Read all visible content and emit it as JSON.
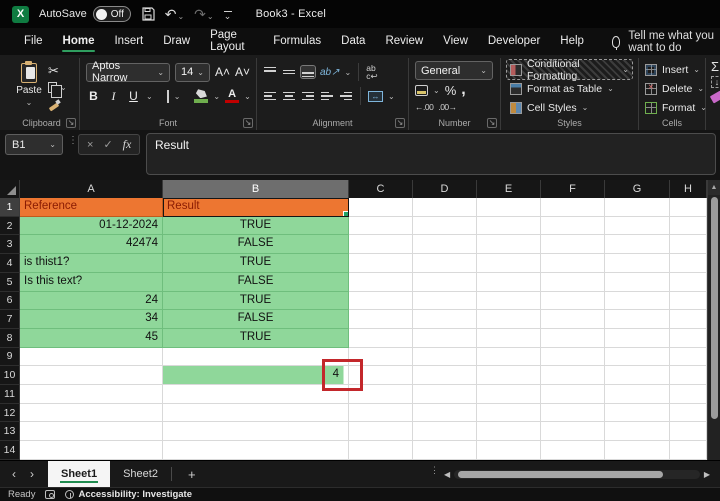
{
  "titlebar": {
    "app_initial": "X",
    "autosave_label": "AutoSave",
    "autosave_state": "Off",
    "doc_title": "Book3  -  Excel"
  },
  "icons": {
    "undo": "↶",
    "redo": "↷",
    "chevron_down": "⌄",
    "cut": "✂",
    "cancel": "×",
    "check": "✓",
    "fx": "fx",
    "dots_vertical": "⋮",
    "percent": "%",
    "comma": ",",
    "autosum": "Σ",
    "fill_down": "↓",
    "bold": "B",
    "italic": "I",
    "underline": "U",
    "font_bigger": "A˄",
    "font_smaller": "A˅",
    "orientation": "ab↗",
    "wrap_line1": "ab",
    "wrap_line2": "c↩",
    "merge": "↔",
    "dec_increase": "←.00",
    "dec_decrease": ".00→",
    "nav_left": "‹",
    "nav_right": "›",
    "add_sheet": "+",
    "scroll_up": "▲",
    "scroll_left": "◀",
    "scroll_right": "▶",
    "launcher": "↘",
    "fontcolor_letter": "A"
  },
  "menu": {
    "tabs": [
      {
        "label": "File"
      },
      {
        "label": "Home"
      },
      {
        "label": "Insert"
      },
      {
        "label": "Draw"
      },
      {
        "label": "Page Layout"
      },
      {
        "label": "Formulas"
      },
      {
        "label": "Data"
      },
      {
        "label": "Review"
      },
      {
        "label": "View"
      },
      {
        "label": "Developer"
      },
      {
        "label": "Help"
      }
    ],
    "active_tab": "Home",
    "tell_me": "Tell me what you want to do"
  },
  "ribbon": {
    "clipboard": {
      "label": "Clipboard",
      "paste": "Paste"
    },
    "font": {
      "label": "Font",
      "font_name": "Aptos Narrow",
      "font_size": "14"
    },
    "alignment": {
      "label": "Alignment"
    },
    "number": {
      "label": "Number",
      "format": "General"
    },
    "styles": {
      "label": "Styles",
      "conditional_formatting": "Conditional Formatting",
      "format_as_table": "Format as Table",
      "cell_styles": "Cell Styles"
    },
    "cells": {
      "label": "Cells",
      "insert": "Insert",
      "delete": "Delete",
      "format": "Format"
    }
  },
  "formula_bar": {
    "name_box": "B1",
    "content": "Result"
  },
  "grid": {
    "columns": [
      "A",
      "B",
      "C",
      "D",
      "E",
      "F",
      "G",
      "H"
    ],
    "selected_column": "B",
    "selected_row": "1",
    "rows": [
      {
        "n": "1",
        "cells": {
          "A": {
            "t": "Reference",
            "s": "orange",
            "a": "l"
          },
          "B": {
            "t": "Result",
            "s": "orange",
            "a": "l",
            "sel": true
          }
        }
      },
      {
        "n": "2",
        "cells": {
          "A": {
            "t": "01-12-2024",
            "s": "green",
            "a": "r"
          },
          "B": {
            "t": "TRUE",
            "s": "green",
            "a": "c"
          }
        }
      },
      {
        "n": "3",
        "cells": {
          "A": {
            "t": "42474",
            "s": "green",
            "a": "r"
          },
          "B": {
            "t": "FALSE",
            "s": "green",
            "a": "c"
          }
        }
      },
      {
        "n": "4",
        "cells": {
          "A": {
            "t": "is thist1?",
            "s": "green",
            "a": "l"
          },
          "B": {
            "t": "TRUE",
            "s": "green",
            "a": "c"
          }
        }
      },
      {
        "n": "5",
        "cells": {
          "A": {
            "t": "Is this text?",
            "s": "green",
            "a": "l"
          },
          "B": {
            "t": "FALSE",
            "s": "green",
            "a": "c"
          }
        }
      },
      {
        "n": "6",
        "cells": {
          "A": {
            "t": "24",
            "s": "green",
            "a": "r"
          },
          "B": {
            "t": "TRUE",
            "s": "green",
            "a": "c"
          }
        }
      },
      {
        "n": "7",
        "cells": {
          "A": {
            "t": "34",
            "s": "green",
            "a": "r"
          },
          "B": {
            "t": "FALSE",
            "s": "green",
            "a": "c"
          }
        }
      },
      {
        "n": "8",
        "cells": {
          "A": {
            "t": "45",
            "s": "green",
            "a": "r"
          },
          "B": {
            "t": "TRUE",
            "s": "green",
            "a": "c"
          }
        }
      },
      {
        "n": "9",
        "cells": {}
      },
      {
        "n": "10",
        "cells": {
          "B": {
            "t": "4",
            "s": "bar",
            "a": "r"
          }
        }
      },
      {
        "n": "11",
        "cells": {}
      },
      {
        "n": "12",
        "cells": {}
      },
      {
        "n": "13",
        "cells": {}
      },
      {
        "n": "14",
        "cells": {}
      }
    ],
    "annotation": {
      "value": "4",
      "color": "#c3272b"
    }
  },
  "sheet_tabs": {
    "tabs": [
      {
        "label": "Sheet1",
        "active": true
      },
      {
        "label": "Sheet2",
        "active": false
      }
    ]
  },
  "status_bar": {
    "mode": "Ready",
    "accessibility": "Accessibility: Investigate"
  },
  "colors": {
    "header_fill_orange": "#ed7631",
    "header_text_red": "#8a1b03",
    "cell_fill_green": "#8fd79a",
    "annotation_red": "#c3272b",
    "accent_green": "#2f9e5f",
    "selected_column_header": "#6e6e6e"
  }
}
